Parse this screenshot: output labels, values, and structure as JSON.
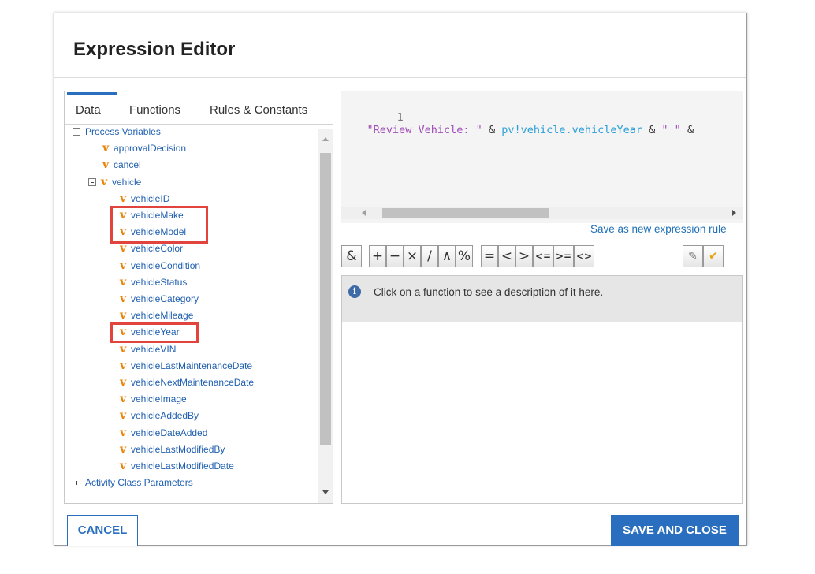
{
  "dialog": {
    "title": "Expression Editor"
  },
  "tabs": [
    {
      "label": "Data",
      "active": true
    },
    {
      "label": "Functions",
      "active": false
    },
    {
      "label": "Rules & Constants",
      "active": false
    }
  ],
  "tree": {
    "process_variables_label": "Process Variables",
    "variable_glyph": "v",
    "top_level": [
      "approvalDecision",
      "cancel",
      "vehicle"
    ],
    "vehicle_fields": [
      "vehicleID",
      "vehicleMake",
      "vehicleModel",
      "vehicleColor",
      "vehicleCondition",
      "vehicleStatus",
      "vehicleCategory",
      "vehicleMileage",
      "vehicleYear",
      "vehicleVIN",
      "vehicleLastMaintenanceDate",
      "vehicleNextMaintenanceDate",
      "vehicleImage",
      "vehicleAddedBy",
      "vehicleDateAdded",
      "vehicleLastModifiedBy",
      "vehicleLastModifiedDate"
    ],
    "activity_params_label": "Activity Class Parameters",
    "highlighted": [
      "vehicleMake",
      "vehicleModel",
      "vehicleYear"
    ],
    "highlight_color": "#e0443c"
  },
  "editor": {
    "line_number": "1",
    "tokens": [
      {
        "text": "\"Review Vehicle: \"",
        "kind": "string"
      },
      {
        "text": " & ",
        "kind": "op"
      },
      {
        "text": "pv!vehicle.vehicleYear",
        "kind": "ref"
      },
      {
        "text": " & ",
        "kind": "op"
      },
      {
        "text": "\" \"",
        "kind": "string"
      },
      {
        "text": " &",
        "kind": "op"
      }
    ],
    "save_rule_link": "Save as new expression rule"
  },
  "operators": [
    "&",
    "+",
    "−",
    "×",
    "/",
    "∧",
    "%",
    "=",
    "<",
    ">",
    "<=",
    ">=",
    "<>"
  ],
  "tools": [
    {
      "name": "magic-wand-icon",
      "glyph": "✎"
    },
    {
      "name": "checkmark-icon",
      "glyph": "✔"
    }
  ],
  "description": {
    "text": "Click on a function to see a description of it here."
  },
  "footer": {
    "cancel": "CANCEL",
    "save_close": "SAVE AND CLOSE"
  },
  "colors": {
    "accent": "#2a6fbf",
    "link": "#1f6fb8",
    "variable_icon": "#e8840a",
    "string_token": "#a14fb8",
    "ref_token": "#2a9fd6"
  }
}
